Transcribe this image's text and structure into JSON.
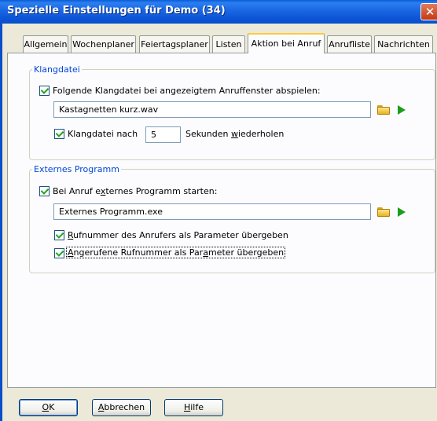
{
  "window": {
    "title": "Spezielle Einstellungen für Demo (34)",
    "close_glyph": "✕"
  },
  "tabs": [
    {
      "label": "Allgemein"
    },
    {
      "label": "Wochenplaner"
    },
    {
      "label": "Feiertagsplaner"
    },
    {
      "label": "Listen"
    },
    {
      "label": "Aktion bei Anruf",
      "active": true
    },
    {
      "label": "Anrufliste"
    },
    {
      "label": "Nachrichten"
    }
  ],
  "klangdatei": {
    "legend": "Klangdatei",
    "play_checkbox_label": "Folgende Klangdatei bei angezeigtem Anruffenster abspielen:",
    "play_checked": true,
    "file_value": "Kastagnetten kurz.wav",
    "repeat_label_before": "Klangdatei nach",
    "repeat_checked": true,
    "repeat_seconds": "5",
    "repeat_label_after_pre": "Sekunden ",
    "repeat_label_after_ul": "w",
    "repeat_label_after_post": "iederholen"
  },
  "extern": {
    "legend": "Externes Programm",
    "start_label_pre": "Bei Anruf e",
    "start_label_ul": "x",
    "start_label_post": "ternes Programm starten:",
    "start_checked": true,
    "program_value": "Externes Programm.exe",
    "param1_ul": "R",
    "param1_rest": "ufnummer des Anrufers als Parameter übergeben",
    "param1_checked": true,
    "param2_ul": "A",
    "param2_rest_pre": "ngerufene Rufnummer als Par",
    "param2_ul2": "a",
    "param2_rest_post": "meter übergeben",
    "param2_checked": true
  },
  "buttons": {
    "ok_ul": "O",
    "ok_rest": "K",
    "cancel_ul": "A",
    "cancel_rest": "bbrechen",
    "help_ul": "H",
    "help_rest": "ilfe"
  },
  "icons": {
    "folder": "folder-open-icon",
    "play": "play-icon",
    "check_color": "#21a121",
    "accent": "#0046d5"
  }
}
